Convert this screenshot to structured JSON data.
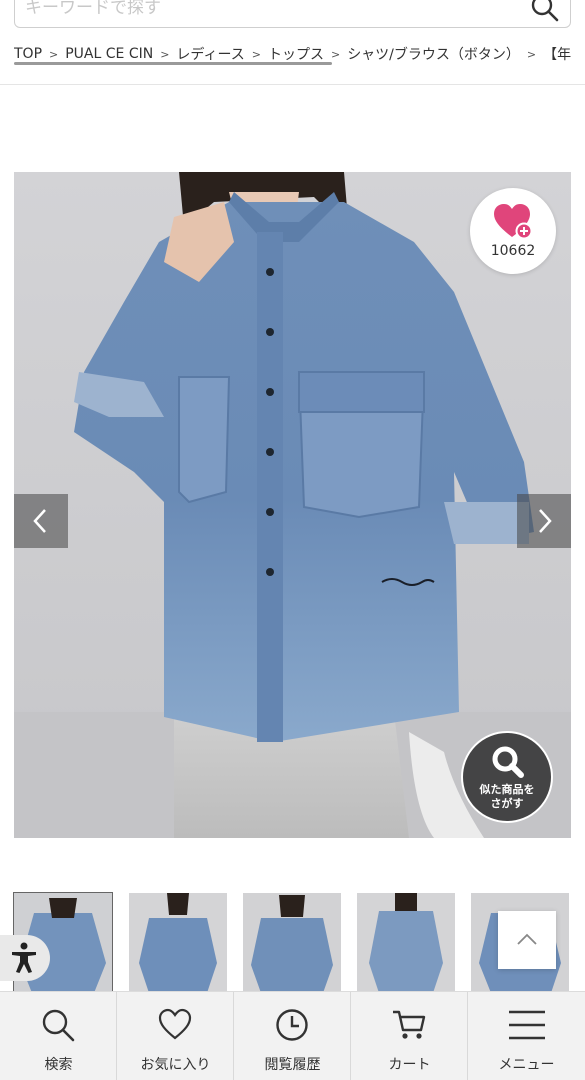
{
  "search": {
    "placeholder": "キーワードで探す",
    "value": "",
    "icon": "search-icon"
  },
  "breadcrumb": {
    "items": [
      "TOP",
      "PUAL CE CIN",
      "レディース",
      "トップス",
      "シャツ/ブラウス（ボタン）",
      "【年"
    ],
    "separator": ">"
  },
  "product": {
    "favorite_count": "10662",
    "similar_button_label_line1": "似た商品を",
    "similar_button_label_line2": "さがす"
  },
  "bottom_nav": {
    "items": [
      {
        "label": "検索",
        "icon": "search-icon"
      },
      {
        "label": "お気に入り",
        "icon": "heart-icon"
      },
      {
        "label": "閲覧履歴",
        "icon": "clock-icon"
      },
      {
        "label": "カート",
        "icon": "cart-icon"
      },
      {
        "label": "メニュー",
        "icon": "menu-icon"
      }
    ]
  },
  "colors": {
    "accent_pink": "#e0457b",
    "nav_bg": "#f2f2f2",
    "text": "#333333"
  }
}
